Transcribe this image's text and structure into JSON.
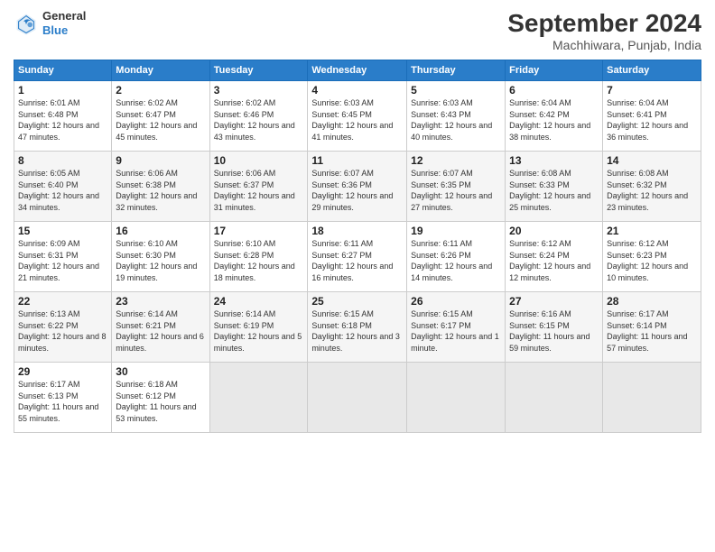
{
  "logo": {
    "line1": "General",
    "line2": "Blue"
  },
  "title": "September 2024",
  "subtitle": "Machhiwara, Punjab, India",
  "days_header": [
    "Sunday",
    "Monday",
    "Tuesday",
    "Wednesday",
    "Thursday",
    "Friday",
    "Saturday"
  ],
  "weeks": [
    [
      {
        "num": "1",
        "sunrise": "Sunrise: 6:01 AM",
        "sunset": "Sunset: 6:48 PM",
        "daylight": "Daylight: 12 hours and 47 minutes."
      },
      {
        "num": "2",
        "sunrise": "Sunrise: 6:02 AM",
        "sunset": "Sunset: 6:47 PM",
        "daylight": "Daylight: 12 hours and 45 minutes."
      },
      {
        "num": "3",
        "sunrise": "Sunrise: 6:02 AM",
        "sunset": "Sunset: 6:46 PM",
        "daylight": "Daylight: 12 hours and 43 minutes."
      },
      {
        "num": "4",
        "sunrise": "Sunrise: 6:03 AM",
        "sunset": "Sunset: 6:45 PM",
        "daylight": "Daylight: 12 hours and 41 minutes."
      },
      {
        "num": "5",
        "sunrise": "Sunrise: 6:03 AM",
        "sunset": "Sunset: 6:43 PM",
        "daylight": "Daylight: 12 hours and 40 minutes."
      },
      {
        "num": "6",
        "sunrise": "Sunrise: 6:04 AM",
        "sunset": "Sunset: 6:42 PM",
        "daylight": "Daylight: 12 hours and 38 minutes."
      },
      {
        "num": "7",
        "sunrise": "Sunrise: 6:04 AM",
        "sunset": "Sunset: 6:41 PM",
        "daylight": "Daylight: 12 hours and 36 minutes."
      }
    ],
    [
      {
        "num": "8",
        "sunrise": "Sunrise: 6:05 AM",
        "sunset": "Sunset: 6:40 PM",
        "daylight": "Daylight: 12 hours and 34 minutes."
      },
      {
        "num": "9",
        "sunrise": "Sunrise: 6:06 AM",
        "sunset": "Sunset: 6:38 PM",
        "daylight": "Daylight: 12 hours and 32 minutes."
      },
      {
        "num": "10",
        "sunrise": "Sunrise: 6:06 AM",
        "sunset": "Sunset: 6:37 PM",
        "daylight": "Daylight: 12 hours and 31 minutes."
      },
      {
        "num": "11",
        "sunrise": "Sunrise: 6:07 AM",
        "sunset": "Sunset: 6:36 PM",
        "daylight": "Daylight: 12 hours and 29 minutes."
      },
      {
        "num": "12",
        "sunrise": "Sunrise: 6:07 AM",
        "sunset": "Sunset: 6:35 PM",
        "daylight": "Daylight: 12 hours and 27 minutes."
      },
      {
        "num": "13",
        "sunrise": "Sunrise: 6:08 AM",
        "sunset": "Sunset: 6:33 PM",
        "daylight": "Daylight: 12 hours and 25 minutes."
      },
      {
        "num": "14",
        "sunrise": "Sunrise: 6:08 AM",
        "sunset": "Sunset: 6:32 PM",
        "daylight": "Daylight: 12 hours and 23 minutes."
      }
    ],
    [
      {
        "num": "15",
        "sunrise": "Sunrise: 6:09 AM",
        "sunset": "Sunset: 6:31 PM",
        "daylight": "Daylight: 12 hours and 21 minutes."
      },
      {
        "num": "16",
        "sunrise": "Sunrise: 6:10 AM",
        "sunset": "Sunset: 6:30 PM",
        "daylight": "Daylight: 12 hours and 19 minutes."
      },
      {
        "num": "17",
        "sunrise": "Sunrise: 6:10 AM",
        "sunset": "Sunset: 6:28 PM",
        "daylight": "Daylight: 12 hours and 18 minutes."
      },
      {
        "num": "18",
        "sunrise": "Sunrise: 6:11 AM",
        "sunset": "Sunset: 6:27 PM",
        "daylight": "Daylight: 12 hours and 16 minutes."
      },
      {
        "num": "19",
        "sunrise": "Sunrise: 6:11 AM",
        "sunset": "Sunset: 6:26 PM",
        "daylight": "Daylight: 12 hours and 14 minutes."
      },
      {
        "num": "20",
        "sunrise": "Sunrise: 6:12 AM",
        "sunset": "Sunset: 6:24 PM",
        "daylight": "Daylight: 12 hours and 12 minutes."
      },
      {
        "num": "21",
        "sunrise": "Sunrise: 6:12 AM",
        "sunset": "Sunset: 6:23 PM",
        "daylight": "Daylight: 12 hours and 10 minutes."
      }
    ],
    [
      {
        "num": "22",
        "sunrise": "Sunrise: 6:13 AM",
        "sunset": "Sunset: 6:22 PM",
        "daylight": "Daylight: 12 hours and 8 minutes."
      },
      {
        "num": "23",
        "sunrise": "Sunrise: 6:14 AM",
        "sunset": "Sunset: 6:21 PM",
        "daylight": "Daylight: 12 hours and 6 minutes."
      },
      {
        "num": "24",
        "sunrise": "Sunrise: 6:14 AM",
        "sunset": "Sunset: 6:19 PM",
        "daylight": "Daylight: 12 hours and 5 minutes."
      },
      {
        "num": "25",
        "sunrise": "Sunrise: 6:15 AM",
        "sunset": "Sunset: 6:18 PM",
        "daylight": "Daylight: 12 hours and 3 minutes."
      },
      {
        "num": "26",
        "sunrise": "Sunrise: 6:15 AM",
        "sunset": "Sunset: 6:17 PM",
        "daylight": "Daylight: 12 hours and 1 minute."
      },
      {
        "num": "27",
        "sunrise": "Sunrise: 6:16 AM",
        "sunset": "Sunset: 6:15 PM",
        "daylight": "Daylight: 11 hours and 59 minutes."
      },
      {
        "num": "28",
        "sunrise": "Sunrise: 6:17 AM",
        "sunset": "Sunset: 6:14 PM",
        "daylight": "Daylight: 11 hours and 57 minutes."
      }
    ],
    [
      {
        "num": "29",
        "sunrise": "Sunrise: 6:17 AM",
        "sunset": "Sunset: 6:13 PM",
        "daylight": "Daylight: 11 hours and 55 minutes."
      },
      {
        "num": "30",
        "sunrise": "Sunrise: 6:18 AM",
        "sunset": "Sunset: 6:12 PM",
        "daylight": "Daylight: 11 hours and 53 minutes."
      },
      null,
      null,
      null,
      null,
      null
    ]
  ]
}
